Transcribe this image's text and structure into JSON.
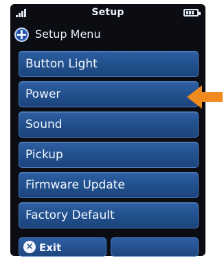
{
  "status_bar": {
    "title": "Setup",
    "signal_icon": "signal-icon",
    "battery_icon": "battery-icon"
  },
  "header": {
    "icon": "dpad-icon",
    "title": "Setup Menu"
  },
  "menu": {
    "items": [
      {
        "label": "Button Light"
      },
      {
        "label": "Power"
      },
      {
        "label": "Sound"
      },
      {
        "label": "Pickup"
      },
      {
        "label": "Firmware Update"
      },
      {
        "label": "Factory Default"
      }
    ]
  },
  "softkeys": {
    "left": {
      "label": "Exit",
      "icon": "close-icon"
    },
    "right": {
      "label": ""
    }
  },
  "annotation": {
    "arrow_icon": "arrow-left-icon",
    "arrow_color": "#f08a1e",
    "points_to": "Power"
  },
  "colors": {
    "screen_bg": "#0b0d12",
    "button_blue": "#23528f",
    "button_border": "#4d7cc0",
    "text": "#f4f8ff"
  }
}
